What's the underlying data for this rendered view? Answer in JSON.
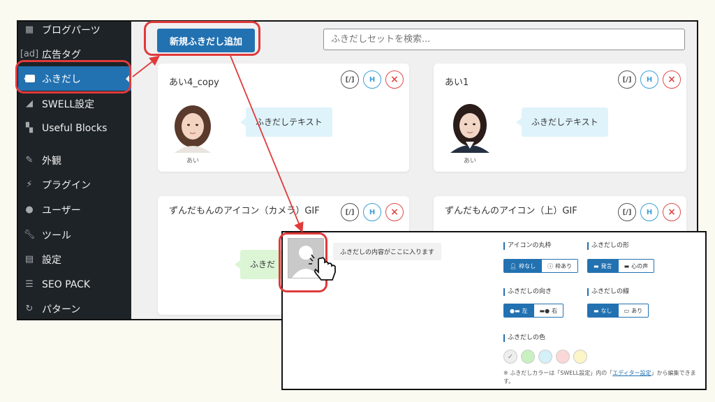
{
  "sidebar": {
    "items": [
      {
        "label": "ブログパーツ",
        "icon": "grid-icon"
      },
      {
        "label": "広告タグ",
        "icon": "ad-icon",
        "icon_text": "[ad]"
      },
      {
        "label": "ふきだし",
        "icon": "speech-bubble-icon",
        "active": true
      },
      {
        "label": "SWELL設定",
        "icon": "swell-icon"
      },
      {
        "label": "Useful Blocks",
        "icon": "blocks-icon"
      },
      {
        "label": "外観",
        "icon": "brush-icon"
      },
      {
        "label": "プラグイン",
        "icon": "plugin-icon"
      },
      {
        "label": "ユーザー",
        "icon": "user-icon"
      },
      {
        "label": "ツール",
        "icon": "wrench-icon"
      },
      {
        "label": "設定",
        "icon": "settings-icon"
      },
      {
        "label": "SEO PACK",
        "icon": "seo-icon"
      },
      {
        "label": "パターン",
        "icon": "pattern-icon"
      }
    ]
  },
  "toolbar": {
    "new_button_label": "新規ふきだし追加",
    "search_placeholder": "ふきだしセットを検索..."
  },
  "cards": [
    {
      "title": "あい4_copy",
      "avatar_name": "あい",
      "bubble_text": "ふきだしテキスト"
    },
    {
      "title": "あい1",
      "avatar_name": "あい",
      "bubble_text": "ふきだしテキスト"
    },
    {
      "title": "ずんだもんのアイコン（カメラ）GIF",
      "bubble_text": "ふきだ"
    },
    {
      "title": "ずんだもんのアイコン（上）GIF"
    }
  ],
  "card_actions": {
    "code": "[/]",
    "copy": "H",
    "delete": "×"
  },
  "panel": {
    "preview_text": "ふきだしの内容がここに入ります",
    "groups": {
      "icon_frame": {
        "label": "アイコンの丸枠",
        "options": [
          "枠なし",
          "枠あり"
        ],
        "selected": 0
      },
      "shape": {
        "label": "ふきだしの形",
        "options": [
          "発言",
          "心の声"
        ],
        "selected": 0
      },
      "direction": {
        "label": "ふきだしの向き",
        "options": [
          "左",
          "右"
        ],
        "selected": 0
      },
      "border": {
        "label": "ふきだしの線",
        "options": [
          "なし",
          "あり"
        ],
        "selected": 0
      },
      "color": {
        "label": "ふきだしの色"
      }
    },
    "swatches": [
      "#eeeeee",
      "#c8f0c0",
      "#d4f0f8",
      "#fbd7d7",
      "#fbf5c8"
    ],
    "swatch_check": "✓",
    "note_prefix": "※ ふきだしカラーは「SWELL設定」内の「",
    "note_link": "エディター設定",
    "note_suffix": "」から編集できます。"
  },
  "colors": {
    "accent": "#2271b1",
    "sidebar_bg": "#1d2327",
    "highlight": "#e03a3a"
  }
}
